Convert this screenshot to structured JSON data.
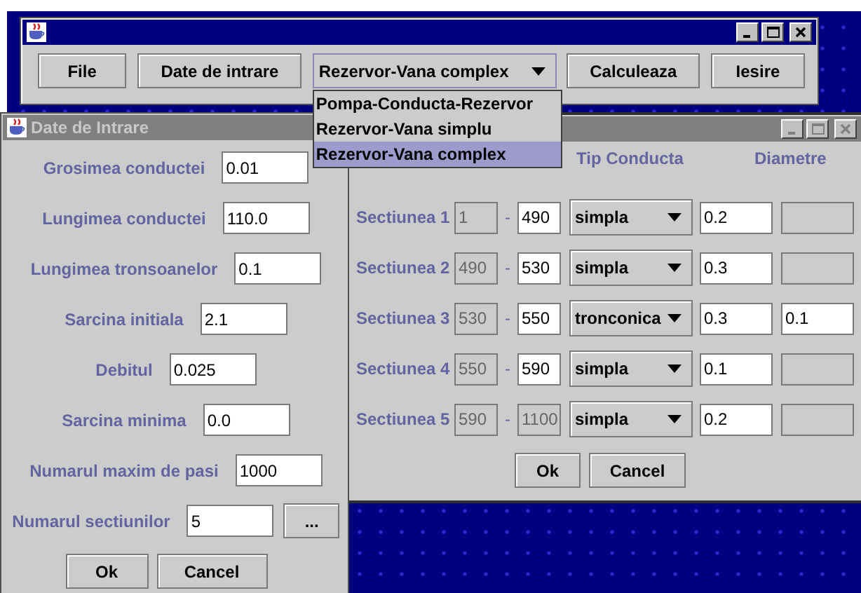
{
  "main_window": {
    "active": true,
    "toolbar": [
      {
        "kind": "button",
        "label": "File"
      },
      {
        "kind": "button",
        "label": "Date de intrare"
      },
      {
        "kind": "combo",
        "value": "Rezervor-Vana complex",
        "expanded": true,
        "options": [
          {
            "label": "Pompa-Conducta-Rezervor",
            "selected": false
          },
          {
            "label": "Rezervor-Vana simplu",
            "selected": false
          },
          {
            "label": "Rezervor-Vana complex",
            "selected": true
          }
        ]
      },
      {
        "kind": "button",
        "label": "Calculeaza"
      },
      {
        "kind": "button",
        "label": "Iesire"
      }
    ]
  },
  "input_window": {
    "title": "Date de Intrare",
    "active": false,
    "fields": [
      {
        "label": "Grosimea conductei",
        "value": "0.01"
      },
      {
        "label": "Lungimea conductei",
        "value": "110.0"
      },
      {
        "label": "Lungimea tronsoanelor",
        "value": "0.1"
      },
      {
        "label": "Sarcina initiala",
        "value": "2.1"
      },
      {
        "label": "Debitul",
        "value": "0.025"
      },
      {
        "label": "Sarcina minima",
        "value": "0.0"
      },
      {
        "label": "Numarul maxim de pasi",
        "value": "1000"
      },
      {
        "label": "Numarul sectiunilor",
        "value": "5",
        "button": "..."
      }
    ],
    "buttons": [
      "Ok",
      "Cancel"
    ]
  },
  "sections_window": {
    "active": false,
    "columns": [
      "Tip Conducta",
      "Diametre"
    ],
    "sections": [
      {
        "label": "Sectiunea 1",
        "from": {
          "value": "1",
          "disabled": true
        },
        "separator": "-",
        "to": {
          "value": "490",
          "disabled": false
        },
        "type": "simpla",
        "diameter": "0.2",
        "diameter_2": {
          "disabled": true
        }
      },
      {
        "label": "Sectiunea 2",
        "from": {
          "value": "490",
          "disabled": true
        },
        "separator": "-",
        "to": {
          "value": "530",
          "disabled": false
        },
        "type": "simpla",
        "diameter": "0.3",
        "diameter_2": {
          "disabled": true
        }
      },
      {
        "label": "Sectiunea 3",
        "from": {
          "value": "530",
          "disabled": true
        },
        "separator": "-",
        "to": {
          "value": "550",
          "disabled": false
        },
        "type": "tronconica",
        "diameter": "0.3",
        "diameter_2": {
          "value": "0.1",
          "disabled": false
        }
      },
      {
        "label": "Sectiunea 4",
        "from": {
          "value": "550",
          "disabled": true
        },
        "separator": "-",
        "to": {
          "value": "590",
          "disabled": false
        },
        "type": "simpla",
        "diameter": "0.1",
        "diameter_2": {
          "disabled": true
        }
      },
      {
        "label": "Sectiunea 5",
        "from": {
          "value": "590",
          "disabled": true
        },
        "separator": "-",
        "to": {
          "value": "1100",
          "disabled": true
        },
        "type": "simpla",
        "diameter": "0.2",
        "diameter_2": {
          "disabled": true
        }
      }
    ],
    "buttons": [
      "Ok",
      "Cancel"
    ]
  }
}
